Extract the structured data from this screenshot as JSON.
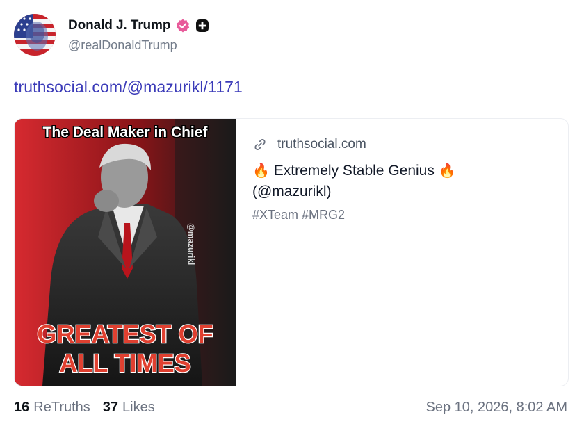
{
  "author": {
    "display_name": "Donald J. Trump",
    "handle": "@realDonaldTrump",
    "verified_color": "#e85a9a",
    "avatar_icon": "avatar-flag-portrait"
  },
  "post": {
    "link_text": "truthsocial.com/@mazurikl/1171"
  },
  "card": {
    "domain": "truthsocial.com",
    "title_emoji": "🔥",
    "title": "Extremely Stable Genius",
    "title_handle": "(@mazurikl)",
    "description": "#XTeam #MRG2",
    "image": {
      "top_text": "The Deal Maker in Chief",
      "watermark": "@mazurikl",
      "bottom_line_1": "GREATEST OF",
      "bottom_line_2": "ALL TIMES"
    }
  },
  "stats": {
    "retruths_count": "16",
    "retruths_label": "ReTruths",
    "likes_count": "37",
    "likes_label": "Likes",
    "timestamp": "Sep 10, 2026, 8:02 AM"
  },
  "colors": {
    "link": "#3a3ab8",
    "muted": "#6b7280",
    "image_red": "#c4232b"
  }
}
